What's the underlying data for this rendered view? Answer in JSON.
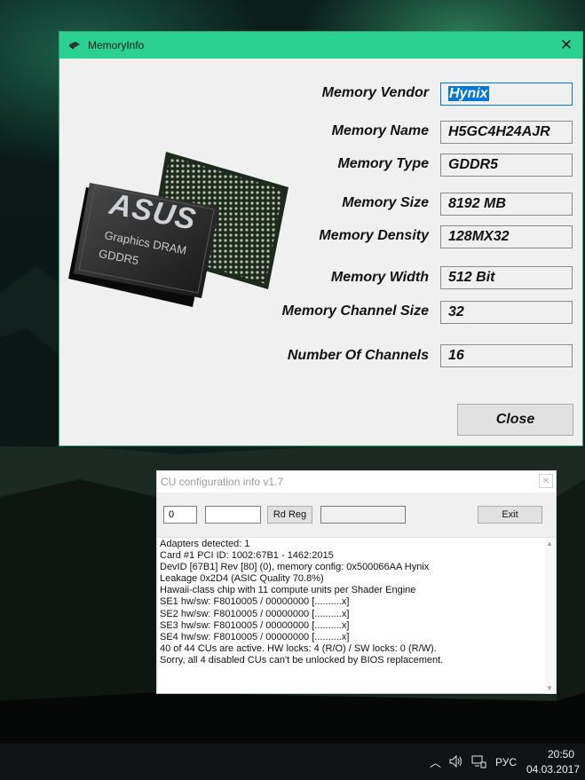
{
  "memory_window": {
    "title": "MemoryInfo",
    "fields": [
      {
        "label": "Memory Vendor",
        "value": "Hynix"
      },
      {
        "label": "Memory Name",
        "value": "H5GC4H24AJR"
      },
      {
        "label": "Memory Type",
        "value": "GDDR5"
      },
      {
        "label": "Memory Size",
        "value": "8192 MB"
      },
      {
        "label": "Memory Density",
        "value": "128MX32"
      },
      {
        "label": "Memory Width",
        "value": "512 Bit"
      },
      {
        "label": "Memory Channel Size",
        "value": "32"
      },
      {
        "label": "Number Of Channels",
        "value": "16"
      }
    ],
    "close_label": "Close",
    "chip": {
      "brand": "ASUS",
      "line1": "Graphics DRAM",
      "line2": "GDDR5"
    }
  },
  "cu_window": {
    "title": "CU configuration info v1.7",
    "input1_value": "0",
    "input2_value": "",
    "rdreg_label": "Rd Reg",
    "output_value": "",
    "exit_label": "Exit",
    "log_lines": [
      "Adapters detected: 1",
      "Card #1 PCI ID: 1002:67B1 - 1462:2015",
      "DevID [67B1] Rev [80] (0), memory config: 0x500066AA Hynix",
      "Leakage 0x2D4 (ASIC Quality 70.8%)",
      "Hawaii-class chip with 11 compute units per Shader Engine",
      "SE1 hw/sw: F8010005 / 00000000 [..........x]",
      "SE2 hw/sw: F8010005 / 00000000 [..........x]",
      "SE3 hw/sw: F8010005 / 00000000 [..........x]",
      "SE4 hw/sw: F8010005 / 00000000 [..........x]",
      "40 of 44 CUs are active. HW locks: 4 (R/O) / SW locks: 0 (R/W).",
      "Sorry, all 4 disabled CUs can't be unlocked by BIOS replacement."
    ]
  },
  "taskbar": {
    "language": "РУС",
    "time": "20:50",
    "date": "04.03.2017"
  },
  "colors": {
    "titlebar": "#2bd192",
    "selection": "#0078d7",
    "taskbar": "#101316"
  }
}
